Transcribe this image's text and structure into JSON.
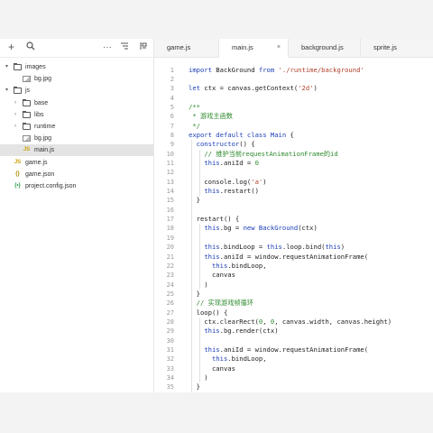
{
  "sidebar": {
    "toolbar": {
      "add_icon": "plus-icon",
      "search_icon": "search-icon",
      "more_icon": "ellipsis-icon",
      "sort_icon": "sort-icon",
      "split_icon": "split-icon"
    },
    "tree": [
      {
        "label": "images",
        "type": "folder",
        "expanded": true
      },
      {
        "label": "bg.jpg",
        "type": "image"
      },
      {
        "label": "js",
        "type": "folder",
        "expanded": true
      },
      {
        "label": "base",
        "type": "folder",
        "expanded": false
      },
      {
        "label": "libs",
        "type": "folder",
        "expanded": false
      },
      {
        "label": "runtime",
        "type": "folder",
        "expanded": false
      },
      {
        "label": "bg.jpg",
        "type": "image"
      },
      {
        "label": "main.js",
        "type": "js",
        "selected": true
      },
      {
        "label": "game.js",
        "type": "js"
      },
      {
        "label": "game.json",
        "type": "json"
      },
      {
        "label": "project.config.json",
        "type": "config"
      }
    ]
  },
  "tabs": [
    {
      "label": "game.js",
      "active": false
    },
    {
      "label": "main.js",
      "active": true,
      "close": "×"
    },
    {
      "label": "background.js",
      "active": false
    },
    {
      "label": "sprite.js",
      "active": false
    }
  ],
  "editor": {
    "line_numbers": [
      "1",
      "2",
      "3",
      "4",
      "5",
      "6",
      "7",
      "8",
      "9",
      "10",
      "11",
      "12",
      "13",
      "14",
      "15",
      "16",
      "17",
      "18",
      "19",
      "20",
      "21",
      "22",
      "23",
      "24",
      "25",
      "26",
      "27",
      "28",
      "29",
      "30",
      "31",
      "32",
      "33",
      "34",
      "35",
      "36"
    ],
    "lines": [
      [
        [
          "kw",
          "import"
        ],
        [
          "p",
          " BackGround "
        ],
        [
          "kw",
          "from"
        ],
        [
          "p",
          " "
        ],
        [
          "str",
          "'./runtime/background'"
        ]
      ],
      [],
      [
        [
          "kw",
          "let"
        ],
        [
          "p",
          " ctx = canvas.getContext("
        ],
        [
          "str",
          "'2d'"
        ],
        [
          "p",
          ")"
        ]
      ],
      [],
      [
        [
          "cmt",
          "/**"
        ]
      ],
      [
        [
          "cmt",
          " * 游戏主函数"
        ]
      ],
      [
        [
          "cmt",
          " */"
        ]
      ],
      [
        [
          "kw",
          "export default class"
        ],
        [
          "p",
          " "
        ],
        [
          "kw",
          "Main"
        ],
        [
          "p",
          " {"
        ]
      ],
      [
        [
          "p",
          "  "
        ],
        [
          "kw",
          "constructor"
        ],
        [
          "p",
          "() {"
        ]
      ],
      [
        [
          "p",
          "    "
        ],
        [
          "cmt",
          "// 维护当前requestAnimationFrame的id"
        ]
      ],
      [
        [
          "p",
          "    "
        ],
        [
          "kw",
          "this"
        ],
        [
          "p",
          ".aniId = "
        ],
        [
          "num",
          "0"
        ]
      ],
      [],
      [
        [
          "p",
          "    console.log("
        ],
        [
          "str",
          "'a'"
        ],
        [
          "p",
          ")"
        ]
      ],
      [
        [
          "p",
          "    "
        ],
        [
          "kw",
          "this"
        ],
        [
          "p",
          ".restart()"
        ]
      ],
      [
        [
          "p",
          "  }"
        ]
      ],
      [],
      [
        [
          "p",
          "  restart() {"
        ]
      ],
      [
        [
          "p",
          "    "
        ],
        [
          "kw",
          "this"
        ],
        [
          "p",
          ".bg = "
        ],
        [
          "kw",
          "new"
        ],
        [
          "p",
          " "
        ],
        [
          "kw",
          "BackGround"
        ],
        [
          "p",
          "(ctx)"
        ]
      ],
      [],
      [
        [
          "p",
          "    "
        ],
        [
          "kw",
          "this"
        ],
        [
          "p",
          ".bindLoop = "
        ],
        [
          "kw",
          "this"
        ],
        [
          "p",
          ".loop.bind("
        ],
        [
          "kw",
          "this"
        ],
        [
          "p",
          ")"
        ]
      ],
      [
        [
          "p",
          "    "
        ],
        [
          "kw",
          "this"
        ],
        [
          "p",
          ".aniId = window.requestAnimationFrame("
        ]
      ],
      [
        [
          "p",
          "      "
        ],
        [
          "kw",
          "this"
        ],
        [
          "p",
          ".bindLoop,"
        ]
      ],
      [
        [
          "p",
          "      canvas"
        ]
      ],
      [
        [
          "p",
          "    )"
        ]
      ],
      [
        [
          "p",
          "  }"
        ]
      ],
      [
        [
          "p",
          "  "
        ],
        [
          "cmt",
          "// 实现游戏帧循环"
        ]
      ],
      [
        [
          "p",
          "  loop() {"
        ]
      ],
      [
        [
          "p",
          "    ctx.clearRect("
        ],
        [
          "num",
          "0"
        ],
        [
          "p",
          ", "
        ],
        [
          "num",
          "0"
        ],
        [
          "p",
          ", canvas.width, canvas.height)"
        ]
      ],
      [
        [
          "p",
          "    "
        ],
        [
          "kw",
          "this"
        ],
        [
          "p",
          ".bg.render(ctx)"
        ]
      ],
      [],
      [
        [
          "p",
          "    "
        ],
        [
          "kw",
          "this"
        ],
        [
          "p",
          ".aniId = window.requestAnimationFrame("
        ]
      ],
      [
        [
          "p",
          "      "
        ],
        [
          "kw",
          "this"
        ],
        [
          "p",
          ".bindLoop,"
        ]
      ],
      [
        [
          "p",
          "      canvas"
        ]
      ],
      [
        [
          "p",
          "    )"
        ]
      ],
      [
        [
          "p",
          "  }"
        ]
      ],
      [
        [
          "p",
          "}"
        ]
      ]
    ]
  },
  "colors": {
    "keyword": "#1c3fb8",
    "string": "#b0402a",
    "comment": "#2e8a2e",
    "js_file": "#c7a000",
    "config_file": "#2a9a4a"
  }
}
